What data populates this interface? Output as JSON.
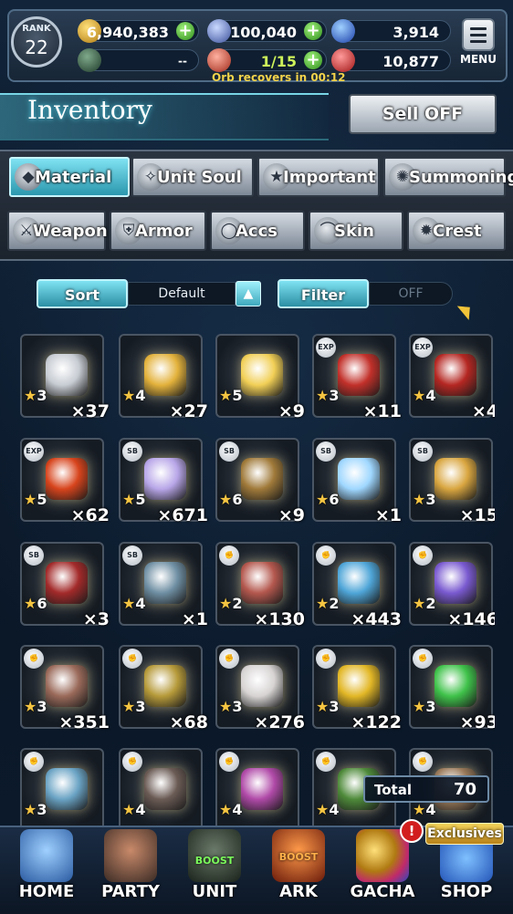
{
  "header": {
    "rank_label": "RANK",
    "rank_value": "22",
    "gil": "6,940,383",
    "lapis": "100,040",
    "blue_orbs": "3,914",
    "blank_counter": "--",
    "orb_count": "1/15",
    "red_orbs": "10,877",
    "orb_recover_text": "Orb recovers in 00:12",
    "menu_label": "MENU"
  },
  "page": {
    "title": "Inventory",
    "sell_off_label": "Sell OFF"
  },
  "tabs": [
    {
      "label": "Material",
      "icon": "bag-icon",
      "active": true
    },
    {
      "label": "Unit Soul",
      "icon": "soul-icon",
      "active": false
    },
    {
      "label": "Important",
      "icon": "star-icon",
      "active": false
    },
    {
      "label": "Summoning",
      "icon": "summon-icon",
      "active": false
    },
    {
      "label": "Weapon",
      "icon": "sword-icon",
      "active": false
    },
    {
      "label": "Armor",
      "icon": "armor-icon",
      "active": false
    },
    {
      "label": "Accs",
      "icon": "ring-icon",
      "active": false
    },
    {
      "label": "Skin",
      "icon": "hanger-icon",
      "active": false
    },
    {
      "label": "Crest",
      "icon": "crest-icon",
      "active": false
    }
  ],
  "sort": {
    "label": "Sort",
    "value": "Default",
    "direction_icon": "triangle-up-icon"
  },
  "filter": {
    "label": "Filter",
    "value": "OFF"
  },
  "items": [
    {
      "icon": "silver-ingot-icon",
      "tag": "",
      "stars": "3",
      "qty": "×37",
      "color": "#c7ccd3"
    },
    {
      "icon": "gold-ingot-icon",
      "tag": "",
      "stars": "4",
      "qty": "×27",
      "color": "#e3b23c"
    },
    {
      "icon": "gold-pile-icon",
      "tag": "",
      "stars": "5",
      "qty": "×9",
      "color": "#f1cf56"
    },
    {
      "icon": "red-potion-icon",
      "tag": "EXP",
      "stars": "3",
      "qty": "×11",
      "color": "#c2302a"
    },
    {
      "icon": "red-flask-icon",
      "tag": "EXP",
      "stars": "4",
      "qty": "×4",
      "color": "#b52722"
    },
    {
      "icon": "fire-vase-icon",
      "tag": "EXP",
      "stars": "5",
      "qty": "×62",
      "color": "#d7441c"
    },
    {
      "icon": "mirror-icon",
      "tag": "SB",
      "stars": "5",
      "qty": "×671",
      "color": "#b8a6e8"
    },
    {
      "icon": "lamp-icon",
      "tag": "SB",
      "stars": "6",
      "qty": "×9",
      "color": "#a07a3a"
    },
    {
      "icon": "crystal-icon",
      "tag": "SB",
      "stars": "6",
      "qty": "×1",
      "color": "#9fd7ff"
    },
    {
      "icon": "ticket-icon",
      "tag": "SB",
      "stars": "3",
      "qty": "×15",
      "color": "#d9a640"
    },
    {
      "icon": "red-ore-icon",
      "tag": "SB",
      "stars": "6",
      "qty": "×3",
      "color": "#a32a2a"
    },
    {
      "icon": "clock-scroll-icon",
      "tag": "SB",
      "stars": "4",
      "qty": "×1",
      "color": "#6f8fa3"
    },
    {
      "icon": "meat-icon",
      "tag": "muscle",
      "stars": "2",
      "qty": "×130",
      "color": "#b4584e"
    },
    {
      "icon": "blue-potion-icon",
      "tag": "muscle",
      "stars": "2",
      "qty": "×443",
      "color": "#4fa6d8"
    },
    {
      "icon": "purple-crystal-icon",
      "tag": "muscle",
      "stars": "2",
      "qty": "×146",
      "color": "#7a5ad0"
    },
    {
      "icon": "horn-icon",
      "tag": "muscle",
      "stars": "3",
      "qty": "×351",
      "color": "#9a6a5a"
    },
    {
      "icon": "gold-stone-icon",
      "tag": "muscle",
      "stars": "3",
      "qty": "×68",
      "color": "#b69a3a"
    },
    {
      "icon": "cloth-bundle-icon",
      "tag": "muscle",
      "stars": "3",
      "qty": "×276",
      "color": "#d7d3d3"
    },
    {
      "icon": "golden-apple-icon",
      "tag": "muscle",
      "stars": "3",
      "qty": "×122",
      "color": "#e2b726"
    },
    {
      "icon": "green-potion-icon",
      "tag": "muscle",
      "stars": "3",
      "qty": "×93",
      "color": "#3fc24a"
    },
    {
      "icon": "bone-icon",
      "tag": "muscle",
      "stars": "3",
      "qty": "",
      "color": "#6aa3c4"
    },
    {
      "icon": "leather-icon",
      "tag": "muscle",
      "stars": "4",
      "qty": "",
      "color": "#6b5b55"
    },
    {
      "icon": "pink-potion-icon",
      "tag": "muscle",
      "stars": "4",
      "qty": "",
      "color": "#b04aa8"
    },
    {
      "icon": "herb-icon",
      "tag": "muscle",
      "stars": "4",
      "qty": "",
      "color": "#4e8a3a"
    },
    {
      "icon": "bottle-icon",
      "tag": "muscle",
      "stars": "4",
      "qty": "",
      "color": "#9a7a5a"
    }
  ],
  "total": {
    "label": "Total",
    "value": "70"
  },
  "nav": [
    {
      "label": "HOME",
      "icon": "home-crest-icon",
      "boost": "",
      "color": "#3a6fb0"
    },
    {
      "label": "PARTY",
      "icon": "party-icon",
      "boost": "",
      "color": "#7a4a3a"
    },
    {
      "label": "UNIT",
      "icon": "unit-icon",
      "boost": "BOOST",
      "color": "#3a4a3a"
    },
    {
      "label": "ARK",
      "icon": "ark-icon",
      "boost": "BOOST",
      "color": "#a0401c"
    },
    {
      "label": "GACHA",
      "icon": "gacha-orbs-icon",
      "boost": "",
      "color": "#b08a2a"
    },
    {
      "label": "SHOP",
      "icon": "shop-icon",
      "boost": "",
      "color": "#2a6fc0"
    }
  ],
  "gacha_alert": "!",
  "exclusives_label": "Exclusives"
}
